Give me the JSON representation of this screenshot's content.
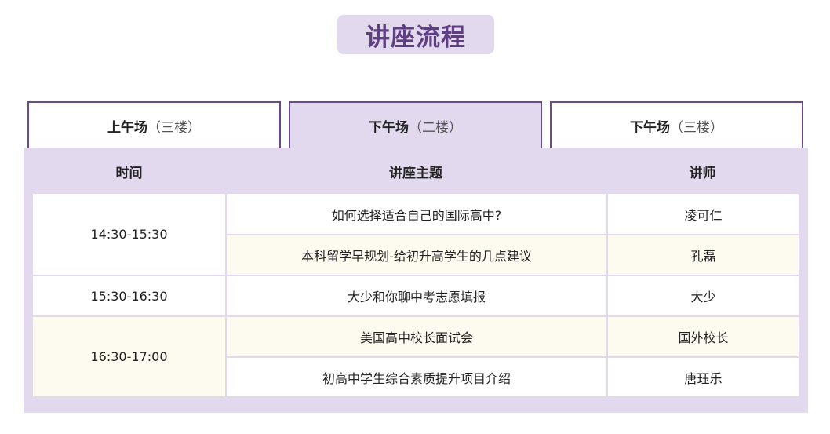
{
  "title": "讲座流程",
  "tabs": [
    {
      "main": "上午场",
      "sub": "（三楼）",
      "active": false
    },
    {
      "main": "下午场",
      "sub": "（二楼）",
      "active": true
    },
    {
      "main": "下午场",
      "sub": "（三楼）",
      "active": false
    }
  ],
  "table": {
    "headers": {
      "time": "时间",
      "topic": "讲座主题",
      "speaker": "讲师"
    },
    "times": [
      "14:30-15:30",
      "15:30-16:30",
      "16:30-17:00"
    ],
    "rows": [
      {
        "topic": "如何选择适合自己的国际高中?",
        "speaker": "凌可仁"
      },
      {
        "topic": "本科留学早规划-给初升高学生的几点建议",
        "speaker": "孔磊"
      },
      {
        "topic": "大少和你聊中考志愿填报",
        "speaker": "大少"
      },
      {
        "topic": "美国高中校长面试会",
        "speaker": "国外校长"
      },
      {
        "topic": "初高中学生综合素质提升项目介绍",
        "speaker": "唐珏乐"
      }
    ]
  },
  "colors": {
    "accent": "#6e4a8c",
    "title_text": "#5f3f82",
    "panel_bg": "#e2d9ee",
    "row_cream": "#fdfbef"
  }
}
